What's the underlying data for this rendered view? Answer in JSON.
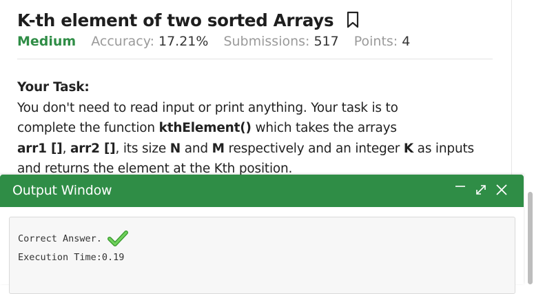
{
  "problem": {
    "title": "K-th element of two sorted Arrays",
    "difficulty": "Medium",
    "accuracy_label": "Accuracy:",
    "accuracy_value": "17.21%",
    "submissions_label": "Submissions:",
    "submissions_value": "517",
    "points_label": "Points:",
    "points_value": "4"
  },
  "task": {
    "heading": "Your Task:",
    "line1": "You don't need to read input or print anything. Your task is to",
    "line2_pre": "complete the function ",
    "line2_bold": "kthElement()",
    "line2_post": " which takes the arrays",
    "line3_arr1": "arr1 []",
    "line3_sep": ", ",
    "line3_arr2": "arr2 []",
    "line3_mid": ", its size ",
    "line3_n": "N",
    "line3_and": " and ",
    "line3_m": "M",
    "line3_resp": " respectively and an integer ",
    "line3_k": "K",
    "line3_end": " as inputs",
    "line4": "and returns the element at the Kth position."
  },
  "output_window": {
    "title": "Output Window",
    "result_text": "Correct Answer.",
    "execution_text": "Execution Time:0.19"
  },
  "icons": {
    "bookmark": "bookmark-icon",
    "minimize": "minimize-icon",
    "expand": "expand-icon",
    "close": "close-icon",
    "check": "check-icon"
  },
  "colors": {
    "brand_green": "#2f8d46",
    "check_green": "#5cc04a"
  }
}
